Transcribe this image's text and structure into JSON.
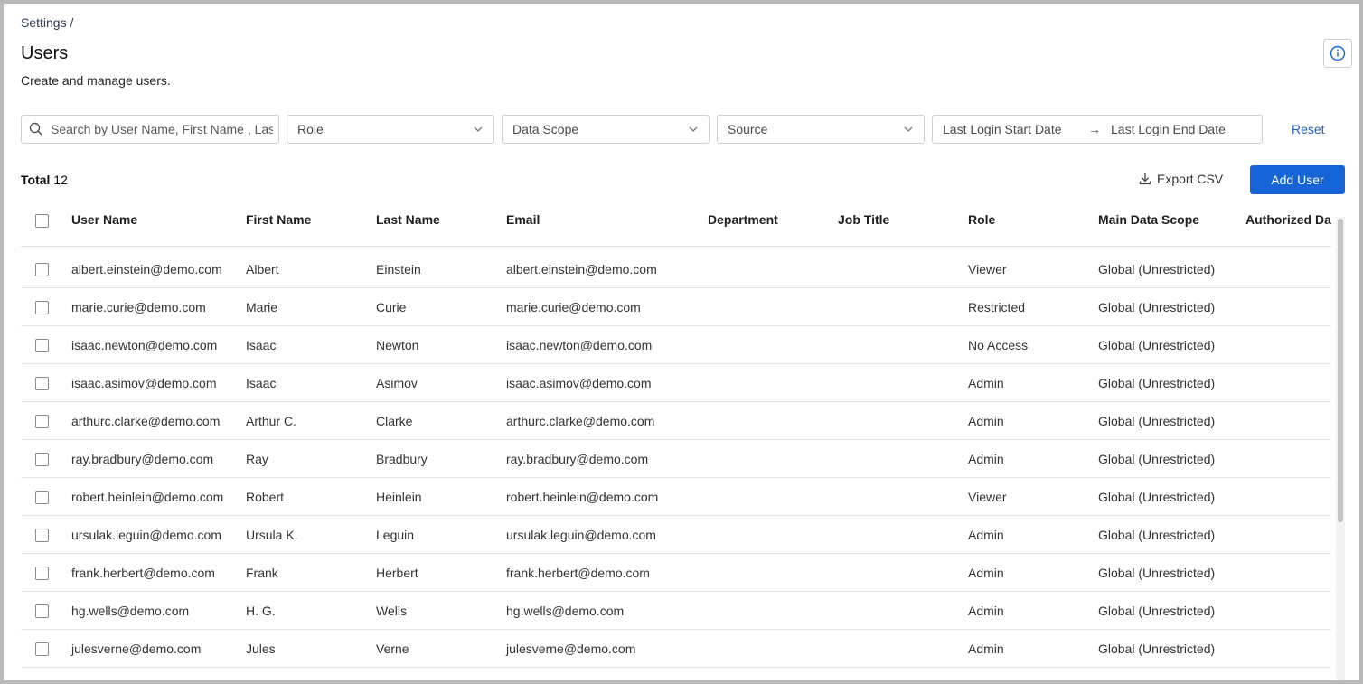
{
  "breadcrumb": "Settings /",
  "page": {
    "title": "Users",
    "subtitle": "Create and manage users."
  },
  "filters": {
    "search_placeholder": "Search by User Name, First Name , Last Name",
    "role": "Role",
    "data_scope": "Data Scope",
    "source": "Source",
    "login_start": "Last Login Start Date",
    "login_end": "Last Login End Date",
    "arrow": "→",
    "reset": "Reset"
  },
  "toolbar": {
    "total_label": "Total",
    "total_count": "12",
    "export_label": "Export CSV",
    "add_label": "Add User"
  },
  "table": {
    "columns": [
      "User Name",
      "First Name",
      "Last Name",
      "Email",
      "Department",
      "Job Title",
      "Role",
      "Main Data Scope",
      "Authorized Data"
    ],
    "rows": [
      {
        "username": "albert.einstein@demo.com",
        "first": "Albert",
        "last": "Einstein",
        "email": "albert.einstein@demo.com",
        "department": "",
        "job_title": "",
        "role": "Viewer",
        "scope": "Global (Unrestricted)",
        "authorized": ""
      },
      {
        "username": "marie.curie@demo.com",
        "first": "Marie",
        "last": "Curie",
        "email": "marie.curie@demo.com",
        "department": "",
        "job_title": "",
        "role": "Restricted",
        "scope": "Global (Unrestricted)",
        "authorized": ""
      },
      {
        "username": "isaac.newton@demo.com",
        "first": "Isaac",
        "last": "Newton",
        "email": "isaac.newton@demo.com",
        "department": "",
        "job_title": "",
        "role": "No Access",
        "scope": "Global (Unrestricted)",
        "authorized": ""
      },
      {
        "username": "isaac.asimov@demo.com",
        "first": "Isaac",
        "last": "Asimov",
        "email": "isaac.asimov@demo.com",
        "department": "",
        "job_title": "",
        "role": "Admin",
        "scope": "Global (Unrestricted)",
        "authorized": ""
      },
      {
        "username": "arthurc.clarke@demo.com",
        "first": "Arthur C.",
        "last": "Clarke",
        "email": "arthurc.clarke@demo.com",
        "department": "",
        "job_title": "",
        "role": "Admin",
        "scope": "Global (Unrestricted)",
        "authorized": ""
      },
      {
        "username": "ray.bradbury@demo.com",
        "first": "Ray",
        "last": "Bradbury",
        "email": "ray.bradbury@demo.com",
        "department": "",
        "job_title": "",
        "role": "Admin",
        "scope": "Global (Unrestricted)",
        "authorized": ""
      },
      {
        "username": "robert.heinlein@demo.com",
        "first": "Robert",
        "last": "Heinlein",
        "email": "robert.heinlein@demo.com",
        "department": "",
        "job_title": "",
        "role": "Viewer",
        "scope": "Global (Unrestricted)",
        "authorized": ""
      },
      {
        "username": "ursulak.leguin@demo.com",
        "first": "Ursula K.",
        "last": "Leguin",
        "email": "ursulak.leguin@demo.com",
        "department": "",
        "job_title": "",
        "role": "Admin",
        "scope": "Global (Unrestricted)",
        "authorized": ""
      },
      {
        "username": "frank.herbert@demo.com",
        "first": "Frank",
        "last": "Herbert",
        "email": "frank.herbert@demo.com",
        "department": "",
        "job_title": "",
        "role": "Admin",
        "scope": "Global (Unrestricted)",
        "authorized": ""
      },
      {
        "username": "hg.wells@demo.com",
        "first": "H. G.",
        "last": "Wells",
        "email": "hg.wells@demo.com",
        "department": "",
        "job_title": "",
        "role": "Admin",
        "scope": "Global (Unrestricted)",
        "authorized": ""
      },
      {
        "username": "julesverne@demo.com",
        "first": "Jules",
        "last": "Verne",
        "email": "julesverne@demo.com",
        "department": "",
        "job_title": "",
        "role": "Admin",
        "scope": "Global (Unrestricted)",
        "authorized": ""
      }
    ]
  },
  "colors": {
    "accent": "#1565d8",
    "link": "#1f5fbf"
  },
  "icons": {
    "info": "info-icon",
    "search": "search-icon",
    "chevron": "chevron-down-icon",
    "download": "download-icon"
  }
}
